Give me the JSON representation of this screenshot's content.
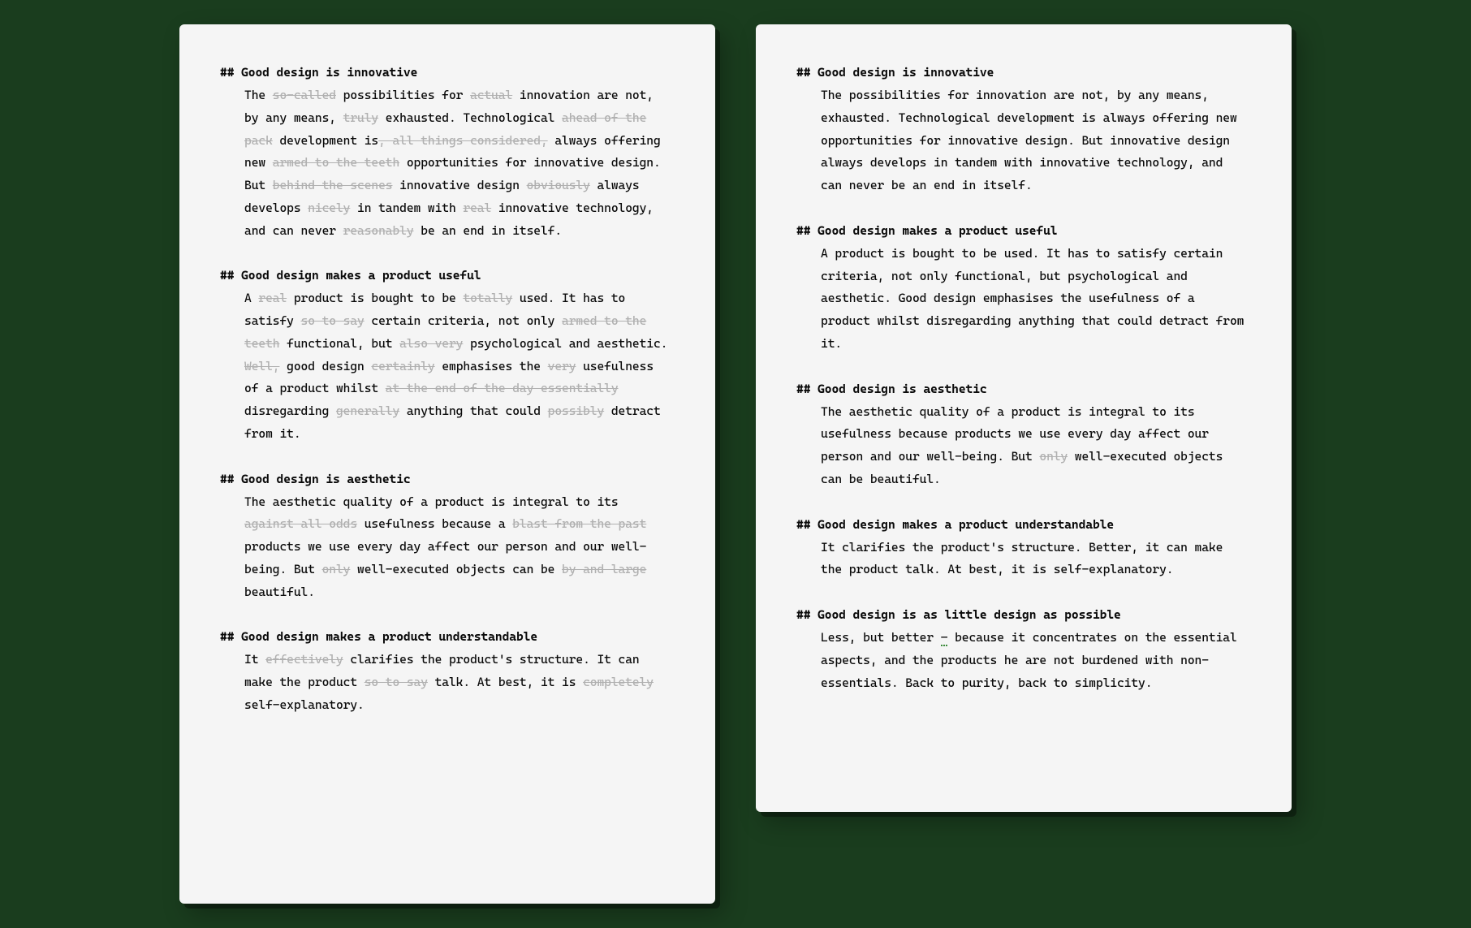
{
  "left": {
    "s1": {
      "heading": "## Good design is innovative",
      "t0": "The ",
      "s0": "so-called",
      "t1": " possibilities for ",
      "s1": "actual",
      "t2": " innovation are not, by any means, ",
      "s2": "truly",
      "t3": " exhausted. Technological ",
      "s3": "ahead of the pack",
      "t4": " development is",
      "s4": ", all things considered,",
      "t5": " always offering new ",
      "s5": "armed to the teeth",
      "t6": " opportunities for innovative design. But ",
      "s6": "behind the scenes",
      "t7": " innovative design ",
      "s7": "obviously",
      "t8": " always develops ",
      "s8": "nicely",
      "t9": " in tandem with ",
      "s9": "real",
      "t10": " innovative technology, and can never ",
      "s10": "reasonably",
      "t11": " be an end in itself."
    },
    "s2": {
      "heading": "## Good design makes a product useful",
      "t0": "A ",
      "s0": "real",
      "t1": " product is bought to be ",
      "s1": "totally",
      "t2": " used. It has to satisfy ",
      "s2": "so to say",
      "t3": " certain criteria, not only ",
      "s3": "armed to the teeth",
      "t4": " functional, but ",
      "s4": "also very",
      "t5": " psychological and aesthetic. ",
      "s5": "Well,",
      "t6": " good design ",
      "s6": "certainly",
      "t7": " emphasises the ",
      "s7": "very",
      "t8": " usefulness of a product whilst ",
      "s8": "at the end of the day essentially",
      "t9": " disregarding ",
      "s9": "generally",
      "t10": " anything that could ",
      "s10": "possibly",
      "t11": " detract from it."
    },
    "s3": {
      "heading": "## Good design is aesthetic",
      "t0": "The aesthetic quality of a product is integral to its ",
      "s0": "against all odds",
      "t1": " usefulness because a ",
      "s1": "blast from the past",
      "t2": " products we use every day affect our person and our well-being. But ",
      "s2": "only",
      "t3": " well-executed objects can be ",
      "s3": "by and large",
      "t4": " beautiful."
    },
    "s4": {
      "heading": "## Good design makes a product understandable",
      "t0": "It ",
      "s0": "effectively",
      "t1": " clarifies the product's structure. It can make the product ",
      "s1": "so to say",
      "t2": " talk. At best, it is ",
      "s2": "completely",
      "t3": " self-explanatory."
    }
  },
  "right": {
    "s1": {
      "heading": "## Good design is innovative",
      "body": "The possibilities for innovation are not, by any means, exhausted. Technological development is always offering new opportunities for innovative design. But innovative design always develops in tandem with innovative technology, and can never be an end in itself."
    },
    "s2": {
      "heading": "## Good design makes a product useful",
      "body": "A product is bought to be used. It has to satisfy certain criteria, not only functional, but psychological and aesthetic. Good design emphasises the usefulness of a product whilst disregarding anything that could detract from it."
    },
    "s3": {
      "heading": "## Good design is aesthetic",
      "t0": "The aesthetic quality of a product is integral to its usefulness because products we use every day affect our person and our well-being. But ",
      "s0": "only",
      "t1": " well-executed objects can be beautiful."
    },
    "s4": {
      "heading": "## Good design makes a product understandable",
      "body": "It clarifies the product's structure. Better, it can make the product talk. At best, it is self-explanatory."
    },
    "s5": {
      "heading": "## Good design is as little design as possible",
      "t0": "Less, but better ",
      "u0": "–",
      "t1": " because it concentrates on the essential aspects, and the products he are not burdened with non-essentials. Back to purity, back to simplicity."
    }
  }
}
